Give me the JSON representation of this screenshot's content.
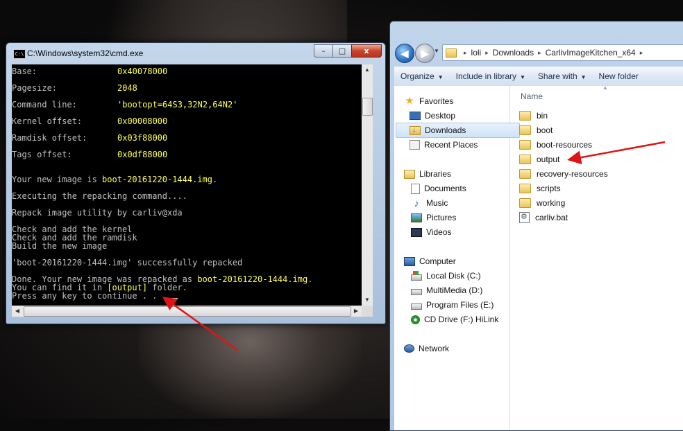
{
  "cmd": {
    "title": "C:\\Windows\\system32\\cmd.exe",
    "icon_label": "C:\\",
    "caption_buttons": {
      "minimize": "–",
      "maximize": "□",
      "close": "x"
    },
    "lines": [
      {
        "key": "Base:",
        "value": "0x40078000"
      },
      {
        "blank": true
      },
      {
        "key": "Pagesize:",
        "value": "2048"
      },
      {
        "blank": true
      },
      {
        "key": "Command line:",
        "value": "'bootopt=64S3,32N2,64N2'"
      },
      {
        "blank": true
      },
      {
        "key": "Kernel offset:",
        "value": "0x00008000"
      },
      {
        "blank": true
      },
      {
        "key": "Ramdisk offset:",
        "value": "0x03f88000"
      },
      {
        "blank": true
      },
      {
        "key": "Tags offset:",
        "value": "0x0df88000"
      },
      {
        "blank": true
      },
      {
        "blank": true
      },
      {
        "text": "Your new image is ",
        "highlight": "boot-20161220-1444.img",
        "after": "."
      },
      {
        "blank": true
      },
      {
        "text": "Executing the repacking command...."
      },
      {
        "blank": true
      },
      {
        "text": "Repack image utility by carliv@xda"
      },
      {
        "blank": true
      },
      {
        "text": "Check and add the kernel"
      },
      {
        "text": "Check and add the ramdisk"
      },
      {
        "text": "Build the new image"
      },
      {
        "blank": true
      },
      {
        "text": "'boot-20161220-1444.img' successfully repacked"
      },
      {
        "blank": true
      },
      {
        "text": "Done. Your new image was repacked as ",
        "highlight": "boot-20161220-1444.img",
        "after": "."
      },
      {
        "text": "You can find it in ",
        "highlight": "[output]",
        "after": " folder."
      },
      {
        "text": "Press any key to continue . . . ",
        "cursor": true
      }
    ]
  },
  "explorer": {
    "breadcrumb": [
      "loli",
      "Downloads",
      "CarlivImageKitchen_x64"
    ],
    "breadcrumb_sep": "▸",
    "toolbar": {
      "organize": "Organize",
      "include_in_library": "Include in library",
      "share_with": "Share with",
      "new_folder": "New folder"
    },
    "nav": {
      "favorites": "Favorites",
      "desktop": "Desktop",
      "downloads": "Downloads",
      "recent_places": "Recent Places",
      "libraries": "Libraries",
      "documents": "Documents",
      "music": "Music",
      "pictures": "Pictures",
      "videos": "Videos",
      "computer": "Computer",
      "local_disk": "Local Disk (C:)",
      "multimedia": "MultiMedia (D:)",
      "program_files": "Program Files (E:)",
      "cd_drive": "CD Drive (F:) HiLink",
      "network": "Network"
    },
    "column_name": "Name",
    "files": [
      {
        "name": "bin",
        "type": "folder"
      },
      {
        "name": "boot",
        "type": "folder"
      },
      {
        "name": "boot-resources",
        "type": "folder"
      },
      {
        "name": "output",
        "type": "folder"
      },
      {
        "name": "recovery-resources",
        "type": "folder"
      },
      {
        "name": "scripts",
        "type": "folder"
      },
      {
        "name": "working",
        "type": "folder"
      },
      {
        "name": "carliv.bat",
        "type": "batch-file"
      }
    ],
    "selected_nav": "Downloads"
  },
  "annotations": {
    "color": "#e01414",
    "arrows": [
      "points-to-output-folder",
      "points-to-output-text"
    ]
  }
}
